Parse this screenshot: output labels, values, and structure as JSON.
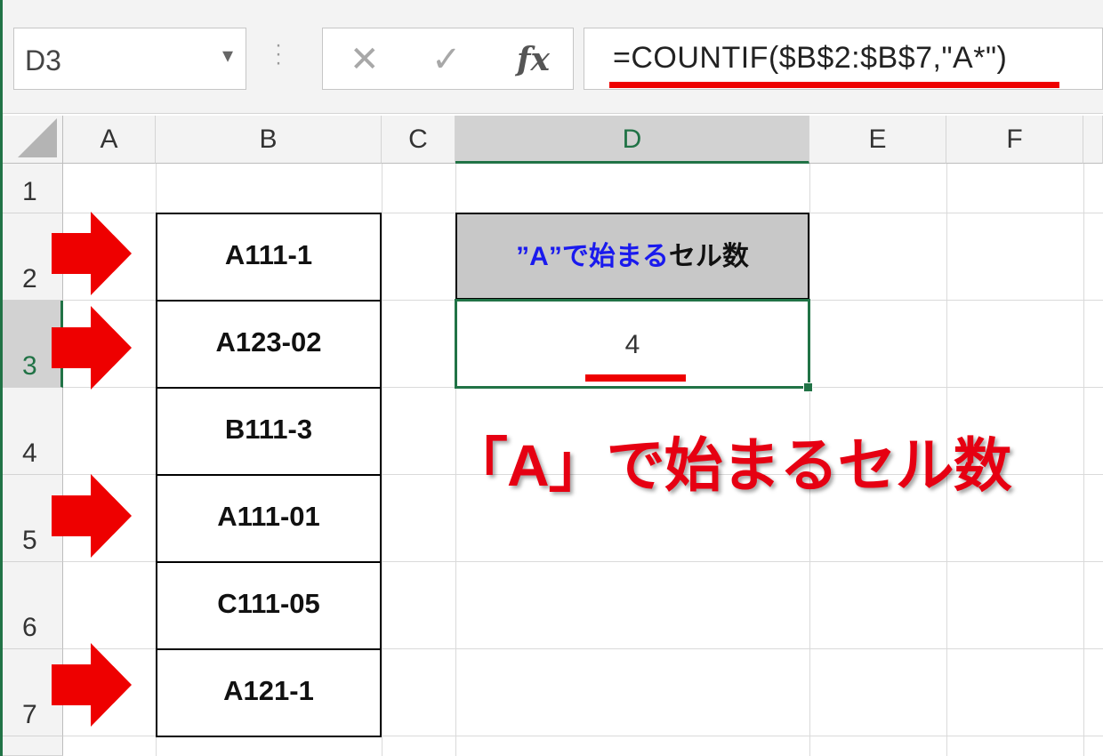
{
  "name_box": {
    "value": "D3"
  },
  "formula_bar": {
    "cancel": "✕",
    "enter": "✓",
    "fx": "fx",
    "formula": "=COUNTIF($B$2:$B$7,\"A*\")"
  },
  "columns": [
    "A",
    "B",
    "C",
    "D",
    "E",
    "F"
  ],
  "rows": [
    "1",
    "2",
    "3",
    "4",
    "5",
    "6",
    "7"
  ],
  "cells": {
    "B": [
      "A111-1",
      "A123-02",
      "B111-3",
      "A111-01",
      "C111-05",
      "A121-1"
    ],
    "D2_blue": "”A”で始まる",
    "D2_black": "セル数",
    "D3": "4"
  },
  "annotation": "「A」で始まるセル数",
  "colors": {
    "excel_green": "#217346",
    "annotation_red": "#e60012",
    "header_fill": "#c8c8c8",
    "blue_text": "#1a1aee"
  },
  "arrow_icon": "right-arrow-icon"
}
